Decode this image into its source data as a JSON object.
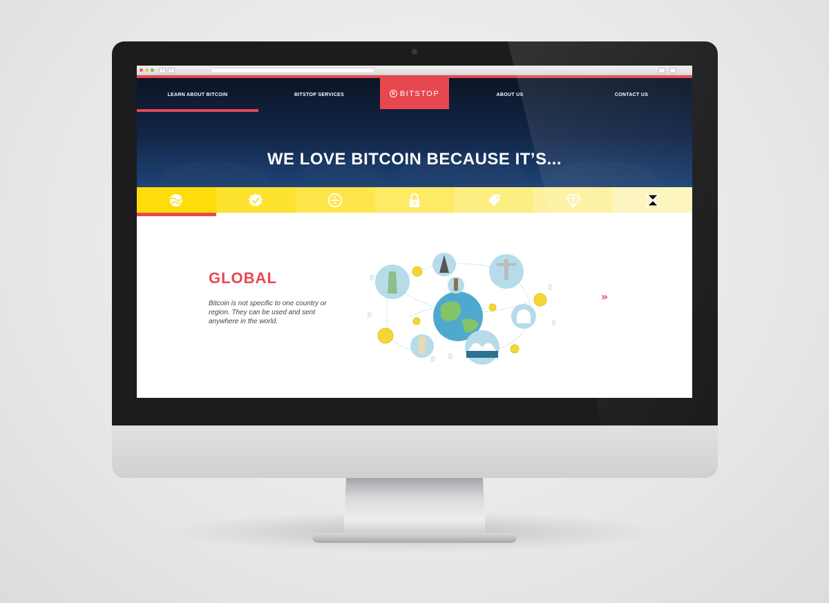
{
  "browser": {
    "back_glyph": "‹",
    "forward_glyph": "›",
    "traffic_lights": [
      "#ee5c55",
      "#f5bf4f",
      "#62c655"
    ]
  },
  "nav": {
    "items": [
      {
        "label": "LEARN ABOUT BITCOIN",
        "active": true
      },
      {
        "label": "BITSTOP SERVICES",
        "active": false
      },
      {
        "label": "ABOUT US",
        "active": false
      },
      {
        "label": "CONTACT US",
        "active": false
      }
    ],
    "logo_text": "BITSTOP",
    "logo_mark": "B"
  },
  "hero": {
    "title": "WE LOVE BITCOIN BECAUSE IT’S..."
  },
  "features": [
    {
      "icon": "globe-icon",
      "color": "#fedc0a",
      "active": true
    },
    {
      "icon": "checkmark-badge-icon",
      "color": "#fde22f"
    },
    {
      "icon": "divide-icon",
      "color": "#fde64b"
    },
    {
      "icon": "padlock-icon",
      "color": "#fdea67"
    },
    {
      "icon": "price-tag-icon",
      "color": "#fdee84"
    },
    {
      "icon": "diamond-icon",
      "color": "#fdf1a0"
    },
    {
      "icon": "network-icon",
      "color": "#fdf5bc"
    }
  ],
  "section": {
    "title": "GLOBAL",
    "body": "Bitcoin is not specific to one country or region.  They can be used and sent anywhere in the world.",
    "next_glyph": "»"
  },
  "colors": {
    "accent": "#e8474f",
    "hero_dark": "#0b1526",
    "hero_light": "#1e4477",
    "yellow": "#fedc0a"
  }
}
